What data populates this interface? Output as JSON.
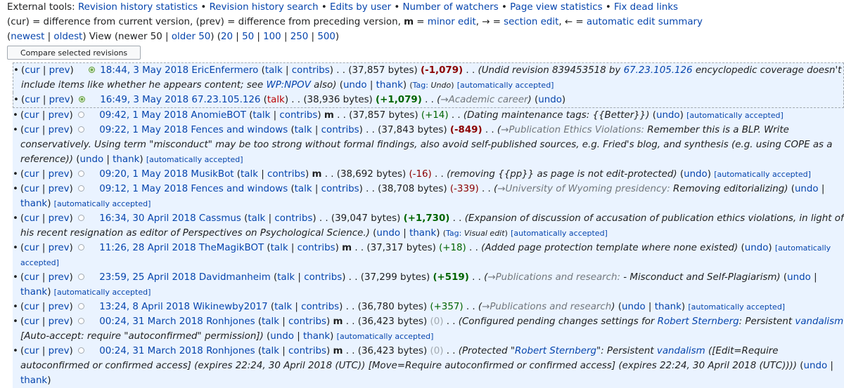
{
  "tools": {
    "label": "External tools:",
    "links": [
      "Revision history statistics",
      "Revision history search",
      "Edits by user",
      "Number of watchers",
      "Page view statistics",
      "Fix dead links"
    ]
  },
  "legend": {
    "cur": "(cur)",
    "cur_desc": " = difference from current version, ",
    "prev": "(prev)",
    "prev_desc": " = difference from preceding version, ",
    "m": "m",
    "m_eq": " = ",
    "minor": "minor edit",
    "arrow_eq": ", → = ",
    "section": "section edit",
    "back_eq": ", ← = ",
    "auto": "automatic edit summary"
  },
  "nav": {
    "newest": "newest",
    "oldest": "oldest",
    "view_text": " View (newer 50 | ",
    "older50": "older 50",
    "close_open": ") (",
    "limits": [
      "20",
      "50",
      "100",
      "250",
      "500"
    ]
  },
  "compare_button": "Compare selected revisions",
  "common": {
    "cur": "cur",
    "prev": "prev",
    "talk": "talk",
    "contribs": "contribs",
    "undo": "undo",
    "thank": "thank",
    "minor": "m",
    "auto_accepted": "[automatically accepted]",
    "tag_label": "Tag:"
  },
  "rows": [
    {
      "time": "18:44, 3 May 2018",
      "user": "EricEnfermero",
      "size": "(37,857 bytes)",
      "diff": "(-1,079)",
      "summary_a": "(Undid revision 839453518 by ",
      "summary_link": "67.23.105.126",
      "summary_b": " encyclopedic coverage doesn't include items like whether he appears content; see ",
      "summary_link2": "WP:NPOV",
      "summary_c": " also)",
      "tag": "Undo"
    },
    {
      "time": "16:49, 3 May 2018",
      "user": "67.23.105.126",
      "size": "(38,936 bytes)",
      "diff": "(+1,079)",
      "section": "→Academic career"
    },
    {
      "time": "09:42, 1 May 2018",
      "user": "AnomieBOT",
      "size": "(37,857 bytes)",
      "diff": "(+14)",
      "summary": "(Dating maintenance tags: {{Better}})"
    },
    {
      "time": "09:22, 1 May 2018",
      "user": "Fences and windows",
      "size": "(37,843 bytes)",
      "diff": "(-849)",
      "section": "→Publication Ethics Violations:",
      "summary": " Remember this is a BLP. Write conservatively. Using term \"misconduct\" may be too strong without formal findings, also avoid self-published sources, e.g. Fried's blog, and synthesis (e.g. using COPE as a reference))"
    },
    {
      "time": "09:20, 1 May 2018",
      "user": "MusikBot",
      "size": "(38,692 bytes)",
      "diff": "(-16)",
      "summary": "(removing {{pp}} as page is not edit-protected)"
    },
    {
      "time": "09:12, 1 May 2018",
      "user": "Fences and windows",
      "size": "(38,708 bytes)",
      "diff": "(-339)",
      "section": "→University of Wyoming presidency:",
      "summary": " Removing editorializing)"
    },
    {
      "time": "16:34, 30 April 2018",
      "user": "Cassmus",
      "size": "(39,047 bytes)",
      "diff": "(+1,730)",
      "summary": "(Expansion of discussion of accusation of publication ethics violations, in light of his recent resignation as editor of Perspectives on Psychological Science.)",
      "tag": "Visual edit"
    },
    {
      "time": "11:26, 28 April 2018",
      "user": "TheMagikBOT",
      "size": "(37,317 bytes)",
      "diff": "(+18)",
      "summary": "(Added page protection template where none existed)"
    },
    {
      "time": "23:59, 25 April 2018",
      "user": "Davidmanheim",
      "size": "(37,299 bytes)",
      "diff": "(+519)",
      "section": "→Publications and research:",
      "summary": " - Misconduct and Self-Plagiarism)"
    },
    {
      "time": "13:24, 8 April 2018",
      "user": "Wikinewby2017",
      "size": "(36,780 bytes)",
      "diff": "(+357)",
      "section": "→Publications and research"
    },
    {
      "time": "00:24, 31 March 2018",
      "user": "Ronhjones",
      "size": "(36,423 bytes)",
      "diff": "(0)",
      "summary_a": "(Configured pending changes settings for ",
      "summary_link": "Robert Sternberg",
      "summary_b": ": Persistent ",
      "summary_link2": "vandalism",
      "summary_c": " [Auto-accept: require \"autoconfirmed\" permission])"
    },
    {
      "time": "00:24, 31 March 2018",
      "user": "Ronhjones",
      "size": "(36,423 bytes)",
      "diff": "(0)",
      "summary_a": "(Protected \"",
      "summary_link": "Robert Sternberg",
      "summary_b": "\": Persistent ",
      "summary_link2": "vandalism",
      "summary_c": " ([Edit=Require autoconfirmed or confirmed access] (expires 22:24, 30 April 2018 (UTC)) [Move=Require autoconfirmed or confirmed access] (expires 22:24, 30 April 2018 (UTC))))"
    }
  ]
}
